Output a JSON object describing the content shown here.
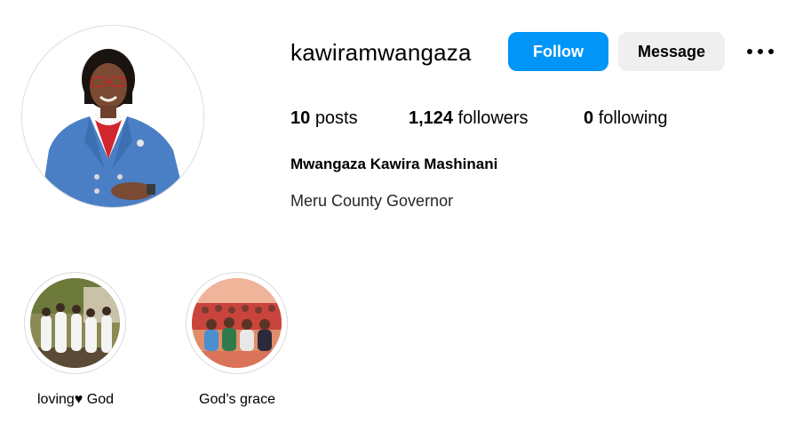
{
  "profile": {
    "username": "kawiramwangaza",
    "full_name": "Mwangaza Kawira Mashinani",
    "bio": "Meru County Governor",
    "avatar_icon": "profile-photo"
  },
  "actions": {
    "follow_label": "Follow",
    "message_label": "Message",
    "more_icon": "more-options-icon"
  },
  "stats": {
    "posts_count": "10",
    "posts_label": "posts",
    "followers_count": "1,124",
    "followers_label": "followers",
    "following_count": "0",
    "following_label": "following"
  },
  "highlights": [
    {
      "label": "loving♥ God"
    },
    {
      "label": "God’s grace"
    }
  ],
  "colors": {
    "follow_button": "#0095f6",
    "message_button": "#efefef",
    "border": "#dbdbdb"
  }
}
